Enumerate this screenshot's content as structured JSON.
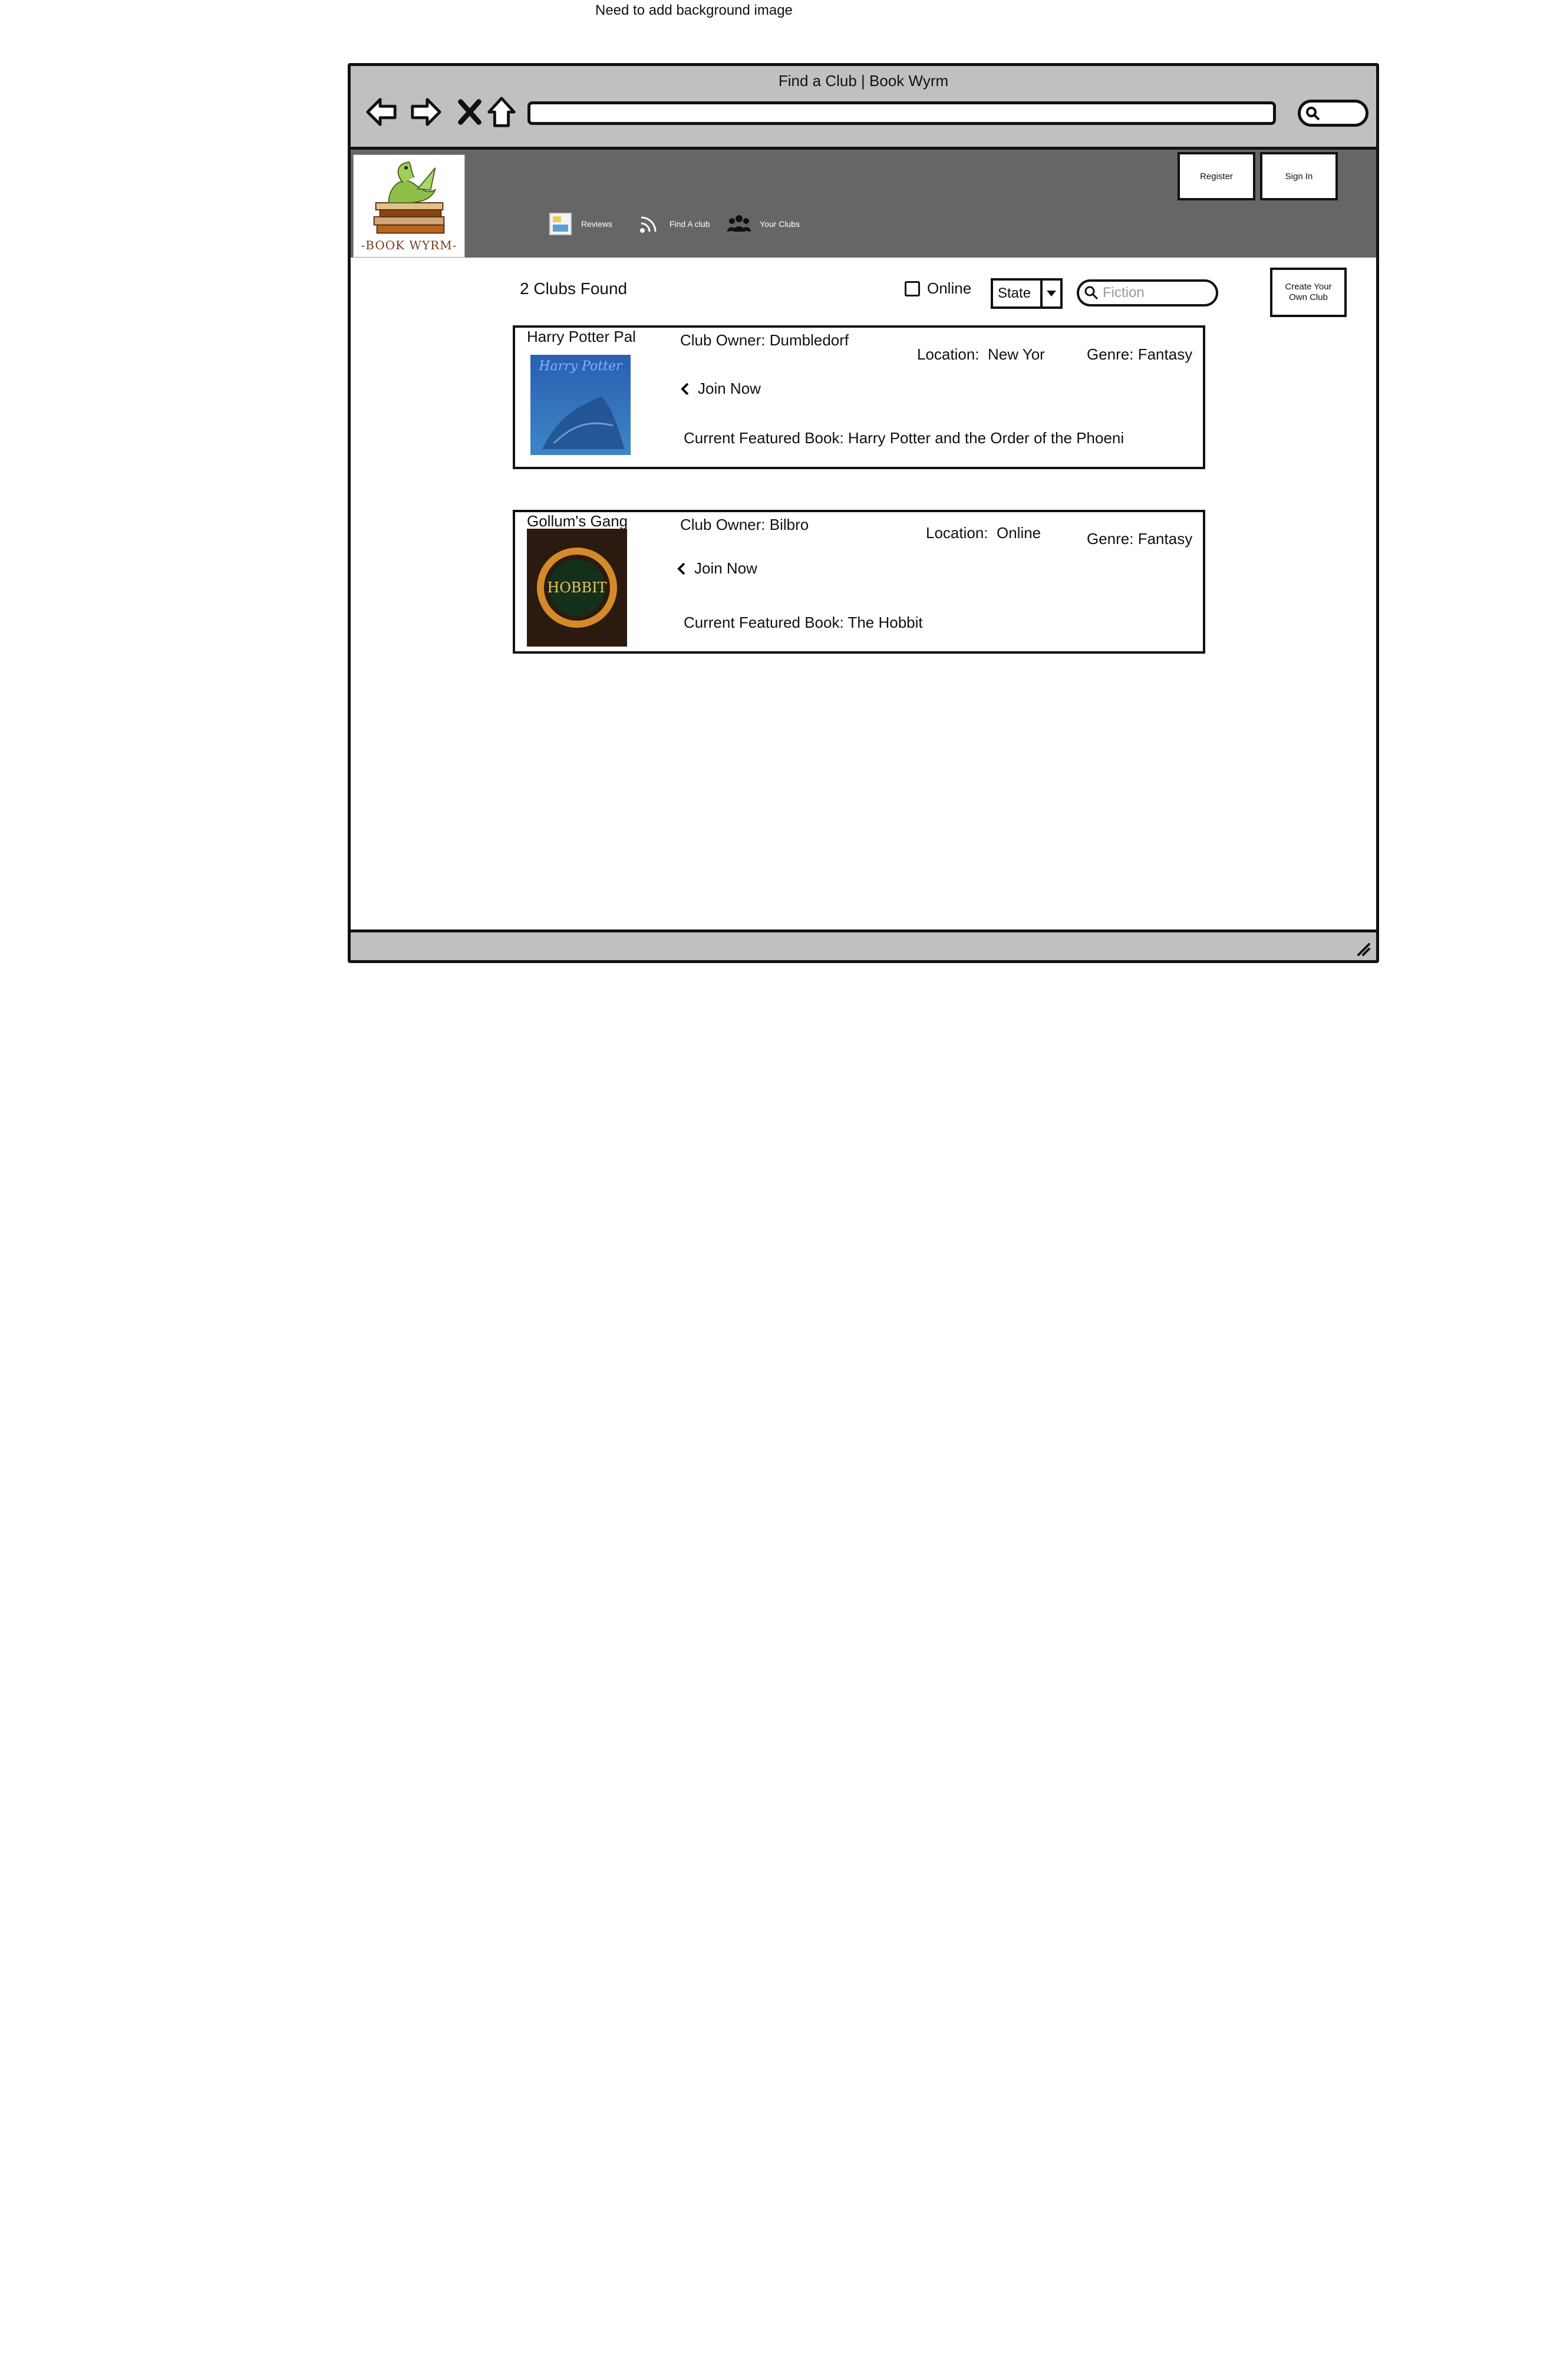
{
  "note": "Need to add background image",
  "window": {
    "title": "Find a Club | Book Wyrm"
  },
  "brand": {
    "logo_text": "-BOOK WYRM-"
  },
  "nav_menu": [
    {
      "label": "Reviews",
      "icon": "reviews-icon"
    },
    {
      "label": "Find A club",
      "icon": "rss-icon"
    },
    {
      "label": "Your Clubs",
      "icon": "group-icon"
    }
  ],
  "header_buttons": {
    "register": "Register",
    "sign_in": "Sign In"
  },
  "toolbar": {
    "clubs_found": "2 Clubs Found",
    "online_label": "Online",
    "online_checked": false,
    "state_value": "State",
    "search_placeholder": "Fiction",
    "create_label": "Create Your Own Club"
  },
  "clubs": [
    {
      "name": "Harry Potter Pal",
      "owner": "Club Owner: Dumbledorf",
      "location_label": "Location:",
      "location_value": "New Yor",
      "genre": "Genre: Fantasy",
      "join_label": "Join Now",
      "featured": "Current Featured Book: Harry Potter and the Order of the Phoeni",
      "cover_title": "Harry Potter"
    },
    {
      "name": "Gollum's Gang",
      "owner": "Club Owner: Bilbro",
      "location_label": "Location:",
      "location_value": "Online",
      "genre": "Genre: Fantasy",
      "join_label": "Join Now",
      "featured": "Current Featured Book: The Hobbit",
      "cover_title": "HOBBIT"
    }
  ],
  "colors": {
    "chrome": "#c0c0c0",
    "header": "#666666",
    "border": "#111111"
  }
}
